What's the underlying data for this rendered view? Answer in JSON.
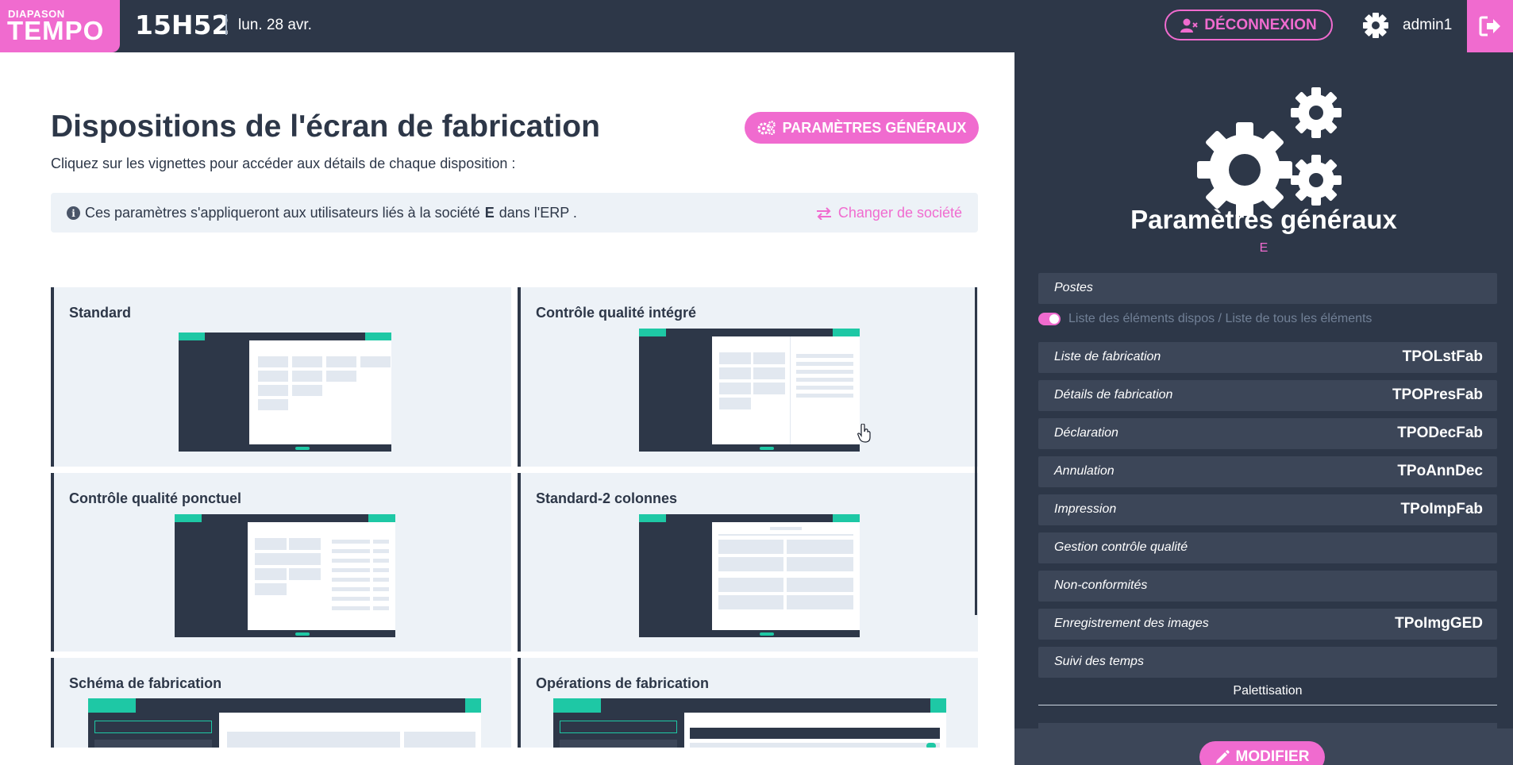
{
  "header": {
    "logo_top": "DIAPASON",
    "logo_main": "TEMPO",
    "time": "15H52",
    "date": "lun. 28 avr.",
    "logout_label": "DÉCONNEXION",
    "username": "admin1"
  },
  "main": {
    "title": "Dispositions de l'écran de fabrication",
    "subtitle": "Cliquez sur les vignettes pour accéder aux détails de chaque disposition :",
    "params_button": "PARAMÈTRES GÉNÉRAUX",
    "info": {
      "before": "Ces paramètres s'appliqueront aux utilisateurs liés à la société",
      "company": "E",
      "after": "dans l'ERP ."
    },
    "change_company": "Changer de société",
    "layouts": [
      {
        "title": "Standard"
      },
      {
        "title": "Contrôle qualité intégré"
      },
      {
        "title": "Contrôle qualité ponctuel"
      },
      {
        "title": "Standard-2 colonnes"
      },
      {
        "title": "Schéma de fabrication"
      },
      {
        "title": "Opérations de fabrication"
      }
    ]
  },
  "panel": {
    "title": "Paramètres généraux",
    "company": "E",
    "postes_label": "Postes",
    "toggle_label": "Liste des éléments dispos / Liste de tous les éléments",
    "rows": [
      {
        "label": "Liste de fabrication",
        "value": "TPOLstFab"
      },
      {
        "label": "Détails de fabrication",
        "value": "TPOPresFab"
      },
      {
        "label": "Déclaration",
        "value": "TPODecFab"
      },
      {
        "label": "Annulation",
        "value": "TPoAnnDec"
      },
      {
        "label": "Impression",
        "value": "TPoImpFab"
      },
      {
        "label": "Gestion contrôle qualité",
        "value": ""
      },
      {
        "label": "Non-conformités",
        "value": ""
      },
      {
        "label": "Enregistrement des images",
        "value": "TPoImgGED"
      },
      {
        "label": "Suivi des temps",
        "value": ""
      }
    ],
    "palettisation": "Palettisation",
    "modify_button": "MODIFIER"
  },
  "colors": {
    "accent": "#f06bcf",
    "dark": "#2d3748",
    "teal": "#1ec8a5",
    "light": "#edf2f7"
  }
}
